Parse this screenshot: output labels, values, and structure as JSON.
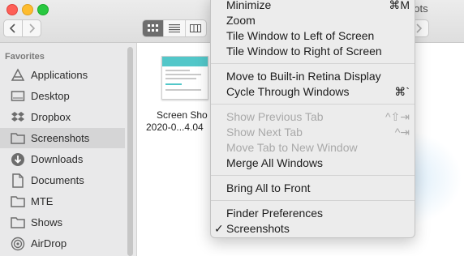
{
  "window": {
    "title_fragment": "hots"
  },
  "sidebar": {
    "header": "Favorites",
    "items": [
      {
        "label": "Applications",
        "icon": "applications-icon"
      },
      {
        "label": "Desktop",
        "icon": "desktop-icon"
      },
      {
        "label": "Dropbox",
        "icon": "dropbox-icon"
      },
      {
        "label": "Screenshots",
        "icon": "folder-icon",
        "selected": true
      },
      {
        "label": "Downloads",
        "icon": "downloads-icon"
      },
      {
        "label": "Documents",
        "icon": "documents-icon"
      },
      {
        "label": "MTE",
        "icon": "folder-icon"
      },
      {
        "label": "Shows",
        "icon": "folder-icon"
      },
      {
        "label": "AirDrop",
        "icon": "airdrop-icon"
      }
    ]
  },
  "file": {
    "name_line1": "Screen Sho",
    "name_line2": "2020-0...4.04"
  },
  "menu": {
    "items": [
      {
        "label": "Minimize",
        "shortcut": "⌘M"
      },
      {
        "label": "Zoom",
        "shortcut": ""
      },
      {
        "label": "Tile Window to Left of Screen",
        "shortcut": ""
      },
      {
        "label": "Tile Window to Right of Screen",
        "shortcut": ""
      },
      {
        "label": "Move to Built-in Retina Display",
        "shortcut": ""
      },
      {
        "label": "Cycle Through Windows",
        "shortcut": "⌘`"
      },
      {
        "label": "Show Previous Tab",
        "shortcut": "^⇧⇥",
        "disabled": true
      },
      {
        "label": "Show Next Tab",
        "shortcut": "^⇥",
        "disabled": true
      },
      {
        "label": "Move Tab to New Window",
        "shortcut": "",
        "disabled": true
      },
      {
        "label": "Merge All Windows",
        "shortcut": ""
      },
      {
        "label": "Bring All to Front",
        "shortcut": ""
      },
      {
        "label": "Finder Preferences",
        "shortcut": ""
      },
      {
        "label": "Screenshots",
        "shortcut": "",
        "checked": true,
        "check": "✓"
      }
    ]
  },
  "colors": {
    "traffic_red": "#fe5f57",
    "traffic_yellow": "#febc2e",
    "traffic_green": "#28c840"
  }
}
